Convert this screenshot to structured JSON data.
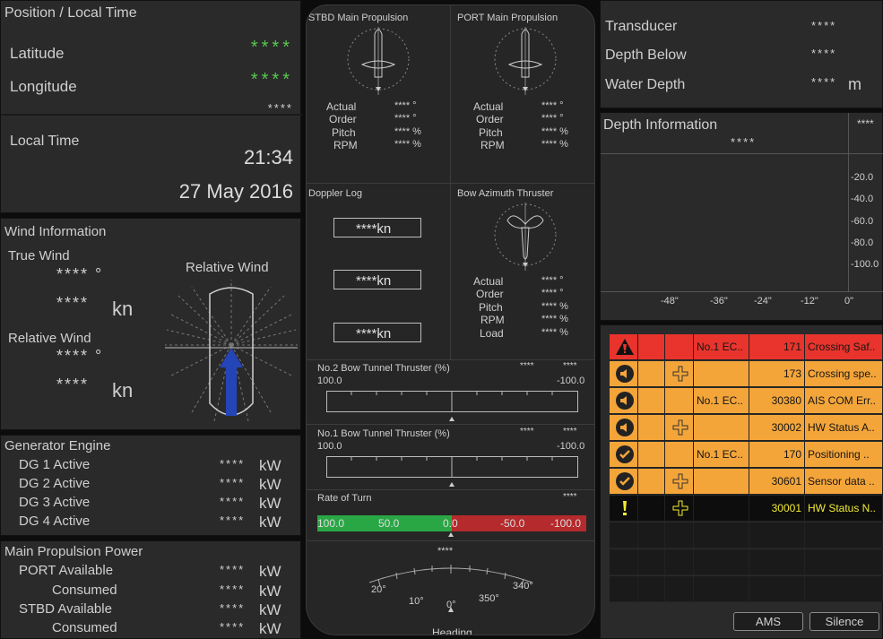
{
  "position": {
    "title": "Position / Local Time",
    "lat_label": "Latitude",
    "lat_value": "****",
    "lon_label": "Longitude",
    "lon_value": "****",
    "extra_value": "****",
    "localtime_label": "Local Time",
    "time": "21:34",
    "date": "27 May 2016"
  },
  "wind": {
    "title": "Wind Information",
    "true_label": "True Wind",
    "true_dir": "**** °",
    "true_speed_val": "****",
    "true_speed_unit": "kn",
    "rel_label": "Relative Wind",
    "rel_dir": "**** °",
    "rel_speed_val": "****",
    "rel_speed_unit": "kn",
    "rel_wind_title": "Relative Wind"
  },
  "generator": {
    "title": "Generator Engine",
    "items": [
      {
        "label": "DG 1  Active",
        "value": "****",
        "unit": "kW"
      },
      {
        "label": "DG 2  Active",
        "value": "****",
        "unit": "kW"
      },
      {
        "label": "DG 3  Active",
        "value": "****",
        "unit": "kW"
      },
      {
        "label": "DG 4  Active",
        "value": "****",
        "unit": "kW"
      }
    ]
  },
  "main_power": {
    "title": "Main Propulsion Power",
    "items": [
      {
        "label": "PORT  Available",
        "value": "****",
        "unit": "kW"
      },
      {
        "label": "Consumed",
        "value": "****",
        "unit": "kW"
      },
      {
        "label": "STBD  Available",
        "value": "****",
        "unit": "kW"
      },
      {
        "label": "Consumed",
        "value": "****",
        "unit": "kW"
      }
    ]
  },
  "stbd": {
    "title": "STBD Main Propulsion",
    "labels": [
      "Actual",
      "Order",
      "Pitch",
      "RPM"
    ],
    "values": [
      "**** °",
      "**** °",
      "**** %",
      "**** %"
    ]
  },
  "port": {
    "title": "PORT Main Propulsion",
    "labels": [
      "Actual",
      "Order",
      "Pitch",
      "RPM"
    ],
    "values": [
      "**** °",
      "**** °",
      "**** %",
      "**** %"
    ]
  },
  "doppler": {
    "title": "Doppler Log",
    "values": [
      "****",
      "****",
      "****"
    ],
    "unit": "kn"
  },
  "bow_az": {
    "title": "Bow Azimuth Thruster",
    "labels": [
      "Actual",
      "Order",
      "Pitch",
      "RPM",
      "Load"
    ],
    "values": [
      "**** °",
      "**** °",
      "**** %",
      "**** %",
      "**** %"
    ]
  },
  "tunnel2": {
    "title": "No.2 Bow Tunnel Thruster (%)",
    "v1": "****",
    "v2": "****",
    "left": "100.0",
    "right": "-100.0",
    "level_percent": 0
  },
  "tunnel1": {
    "title": "No.1 Bow Tunnel Thruster (%)",
    "v1": "****",
    "v2": "****",
    "left": "100.0",
    "right": "-100.0",
    "level_percent": 0
  },
  "rot": {
    "title": "Rate of Turn",
    "value": "****",
    "labels": [
      "100.0",
      "50.0",
      "0.0",
      "-50.0",
      "-100.0"
    ],
    "current": 0
  },
  "heading": {
    "value": "****",
    "label": "Heading",
    "ticks": [
      "20°",
      "10°",
      "0°",
      "350°",
      "340°"
    ]
  },
  "depth": {
    "transducer_label": "Transducer",
    "transducer_value": "****",
    "below_label": "Depth Below",
    "below_value": "****",
    "water_label": "Water Depth",
    "water_value": "****",
    "water_unit": "m",
    "info_title": "Depth Information",
    "info_value": "****",
    "info_corner": "****",
    "y_ticks": [
      "-20.0",
      "-40.0",
      "-60.0",
      "-80.0",
      "-100.0"
    ],
    "x_ticks": [
      "-48\"",
      "-36\"",
      "-24\"",
      "-12\"",
      "0\""
    ]
  },
  "alarms": {
    "rows": [
      {
        "icon": "warning-triangle-icon",
        "cross": false,
        "source": "No.1 EC..",
        "id": "171",
        "text": "Crossing Saf..",
        "color": "#e8342c"
      },
      {
        "icon": "speaker-icon",
        "cross": true,
        "source": "",
        "id": "173",
        "text": "Crossing spe..",
        "color": "#f4a53a"
      },
      {
        "icon": "speaker-icon",
        "cross": false,
        "source": "No.1 EC..",
        "id": "30380",
        "text": "AIS COM Err..",
        "color": "#f4a53a"
      },
      {
        "icon": "speaker-icon",
        "cross": true,
        "source": "",
        "id": "30002",
        "text": "HW Status A..",
        "color": "#f4a53a"
      },
      {
        "icon": "check-icon",
        "cross": false,
        "source": "No.1 EC..",
        "id": "170",
        "text": "Positioning ..",
        "color": "#f4a53a"
      },
      {
        "icon": "check-icon",
        "cross": true,
        "source": "",
        "id": "30601",
        "text": "Sensor data ..",
        "color": "#f4a53a"
      },
      {
        "icon": "exclamation-icon",
        "cross": true,
        "source": "",
        "id": "30001",
        "text": "HW Status N..",
        "color": "#0d0d0d"
      }
    ],
    "ams_label": "AMS",
    "silence_label": "Silence"
  }
}
